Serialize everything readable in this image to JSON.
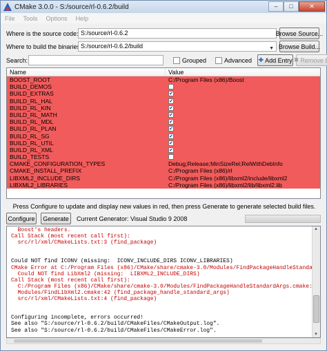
{
  "window": {
    "title": "CMake 3.0.0 - S:/source/rl-0.6.2/build",
    "minimize": "–",
    "maximize": "□",
    "close": "✕",
    "icon": "cmake-logo"
  },
  "menu": [
    "File",
    "Tools",
    "Options",
    "Help"
  ],
  "source": {
    "label": "Where is the source code:",
    "value": "S:/source/rl-0.6.2",
    "browse_label": "Browse Source..."
  },
  "build": {
    "label": "Where to build the binaries:",
    "value": "S:/source/rl-0.6.2/build",
    "browse_label": "Browse Build..."
  },
  "search": {
    "label": "Search:",
    "value": "",
    "grouped_label": "Grouped",
    "advanced_label": "Advanced",
    "add_label": "Add Entry",
    "remove_label": "Remove Entry"
  },
  "table": {
    "headers": [
      "Name",
      "Value"
    ],
    "row_color": "#f25b5b",
    "rows": [
      {
        "name": "BOOST_ROOT",
        "value": "C:/Program Files (x86)/Boost",
        "type": "text"
      },
      {
        "name": "BUILD_DEMOS",
        "value": "",
        "type": "check",
        "checked": false
      },
      {
        "name": "BUILD_EXTRAS",
        "value": "",
        "type": "check",
        "checked": true
      },
      {
        "name": "BUILD_RL_HAL",
        "value": "",
        "type": "check",
        "checked": true
      },
      {
        "name": "BUILD_RL_KIN",
        "value": "",
        "type": "check",
        "checked": true
      },
      {
        "name": "BUILD_RL_MATH",
        "value": "",
        "type": "check",
        "checked": true
      },
      {
        "name": "BUILD_RL_MDL",
        "value": "",
        "type": "check",
        "checked": true
      },
      {
        "name": "BUILD_RL_PLAN",
        "value": "",
        "type": "check",
        "checked": true
      },
      {
        "name": "BUILD_RL_SG",
        "value": "",
        "type": "check",
        "checked": true
      },
      {
        "name": "BUILD_RL_UTIL",
        "value": "",
        "type": "check",
        "checked": true
      },
      {
        "name": "BUILD_RL_XML",
        "value": "",
        "type": "check",
        "checked": true
      },
      {
        "name": "BUILD_TESTS",
        "value": "",
        "type": "check",
        "checked": false
      },
      {
        "name": "CMAKE_CONFIGURATION_TYPES",
        "value": "Debug;Release;MinSizeRel;RelWithDebInfo",
        "type": "text"
      },
      {
        "name": "CMAKE_INSTALL_PREFIX",
        "value": "C:/Program Files (x86)/rl",
        "type": "text"
      },
      {
        "name": "LIBXML2_INCLUDE_DIRS",
        "value": "C:/Program Files (x86)/libxml2/include/libxml2",
        "type": "text"
      },
      {
        "name": "LIBXML2_LIBRARIES",
        "value": "C:/Program Files (x86)/libxml2/lib/libxml2.lib",
        "type": "text"
      }
    ]
  },
  "info": "Press Configure to update and display new values in red, then press Generate to generate selected build files.",
  "actions": {
    "configure_label": "Configure",
    "generate_label": "Generate",
    "generator_label": "Current Generator: Visual Studio 9 2008"
  },
  "output": {
    "lines": [
      {
        "text": "  Boost's headers.",
        "err": true
      },
      {
        "text": "Call Stack (most recent call first):",
        "err": true
      },
      {
        "text": "  src/rl/xml/CMakeLists.txt:3 (find_package)",
        "err": true
      },
      {
        "text": "",
        "err": false
      },
      {
        "text": "",
        "err": false
      },
      {
        "text": "Could NOT find ICONV (missing:  ICONV_INCLUDE_DIRS ICONV_LIBRARIES)",
        "err": false
      },
      {
        "text": "CMake Error at C:/Program Files (x86)/CMake/share/cmake-3.0/Modules/FindPackageHandleStandardAr",
        "err": true
      },
      {
        "text": "  Could NOT find LibXml2 (missing:  LIBXML2_INCLUDE_DIRS)",
        "err": true
      },
      {
        "text": "Call Stack (most recent call first):",
        "err": true
      },
      {
        "text": "  C:/Program Files (x86)/CMake/share/cmake-3.0/Modules/FindPackageHandleStandardArgs.cmake:343",
        "err": true
      },
      {
        "text": "  Modules/FindLibXml2.cmake:42 (find_package_handle_standard_args)",
        "err": true
      },
      {
        "text": "  src/rl/xml/CMakeLists.txt:4 (find_package)",
        "err": true
      },
      {
        "text": "",
        "err": false
      },
      {
        "text": "",
        "err": false
      },
      {
        "text": "Configuring incomplete, errors occurred!",
        "err": false
      },
      {
        "text": "See also \"S:/source/rl-0.6.2/build/CMakeFiles/CMakeOutput.log\".",
        "err": false
      },
      {
        "text": "See also \"S:/source/rl-0.6.2/build/CMakeFiles/CMakeError.log\".",
        "err": false
      }
    ]
  }
}
